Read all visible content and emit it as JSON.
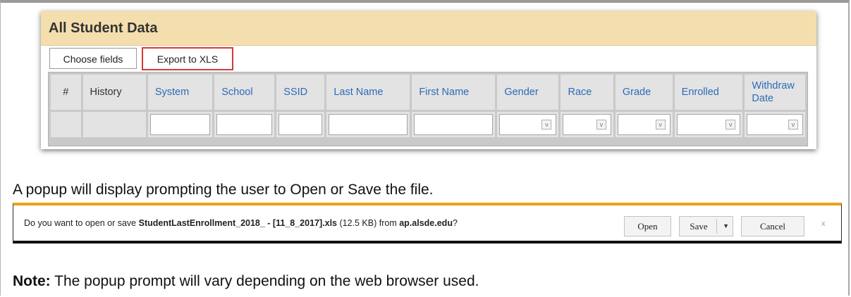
{
  "panel": {
    "title": "All Student Data",
    "buttons": {
      "choose_fields": "Choose fields",
      "export_xls": "Export to XLS"
    },
    "columns": [
      {
        "label": "#",
        "linked": false
      },
      {
        "label": "History",
        "linked": false
      },
      {
        "label": "System",
        "linked": true
      },
      {
        "label": "School",
        "linked": true
      },
      {
        "label": "SSID",
        "linked": true
      },
      {
        "label": "Last Name",
        "linked": true
      },
      {
        "label": "First Name",
        "linked": true
      },
      {
        "label": "Gender",
        "linked": true
      },
      {
        "label": "Race",
        "linked": true
      },
      {
        "label": "Grade",
        "linked": true
      },
      {
        "label": "Enrolled",
        "linked": true
      },
      {
        "label": "Withdraw Date",
        "linked": true
      }
    ],
    "select_arrow_glyph": "v"
  },
  "text": {
    "line1": "A popup will display prompting the user to Open or Save the file.",
    "note_label": "Note:",
    "note_text": " The popup prompt will vary depending on the web browser used."
  },
  "popup": {
    "msg_prefix": "Do you want to open or save ",
    "filename": "StudentLastEnrollment_2018_ - [11_8_2017].xls",
    "size": " (12.5 KB) from ",
    "domain": "ap.alsde.edu",
    "msg_suffix": "?",
    "open_label": "Open",
    "save_label": "Save",
    "save_arrow": "▼",
    "cancel_label": "Cancel",
    "close_glyph": "x"
  },
  "colors": {
    "title_bar": "#f5deae",
    "link_header": "#2e6ab8",
    "export_border": "#d23a3a",
    "popup_accent": "#e8a21a"
  }
}
